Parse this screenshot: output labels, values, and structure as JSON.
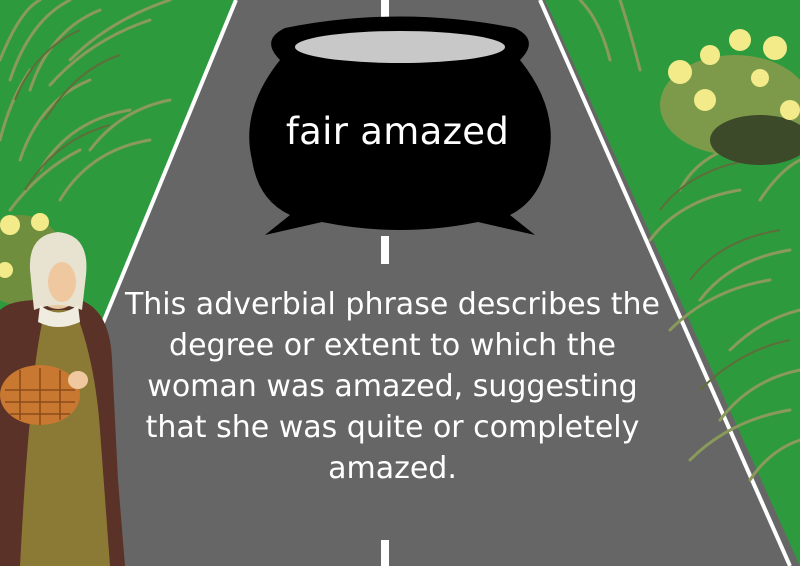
{
  "card": {
    "phrase": "fair amazed",
    "explanation": "This adverbial phrase describes the degree or extent to which the woman was amazed, suggesting that she was quite or completely amazed."
  },
  "colors": {
    "grass": "#2e9a3e",
    "road": "#666666",
    "road_lines": "#ffffff",
    "cauldron": "#000000",
    "text": "#ffffff"
  },
  "illustration": {
    "background": "road-through-grass",
    "character": "peasant-woman-with-basket",
    "object": "black-cauldron"
  }
}
